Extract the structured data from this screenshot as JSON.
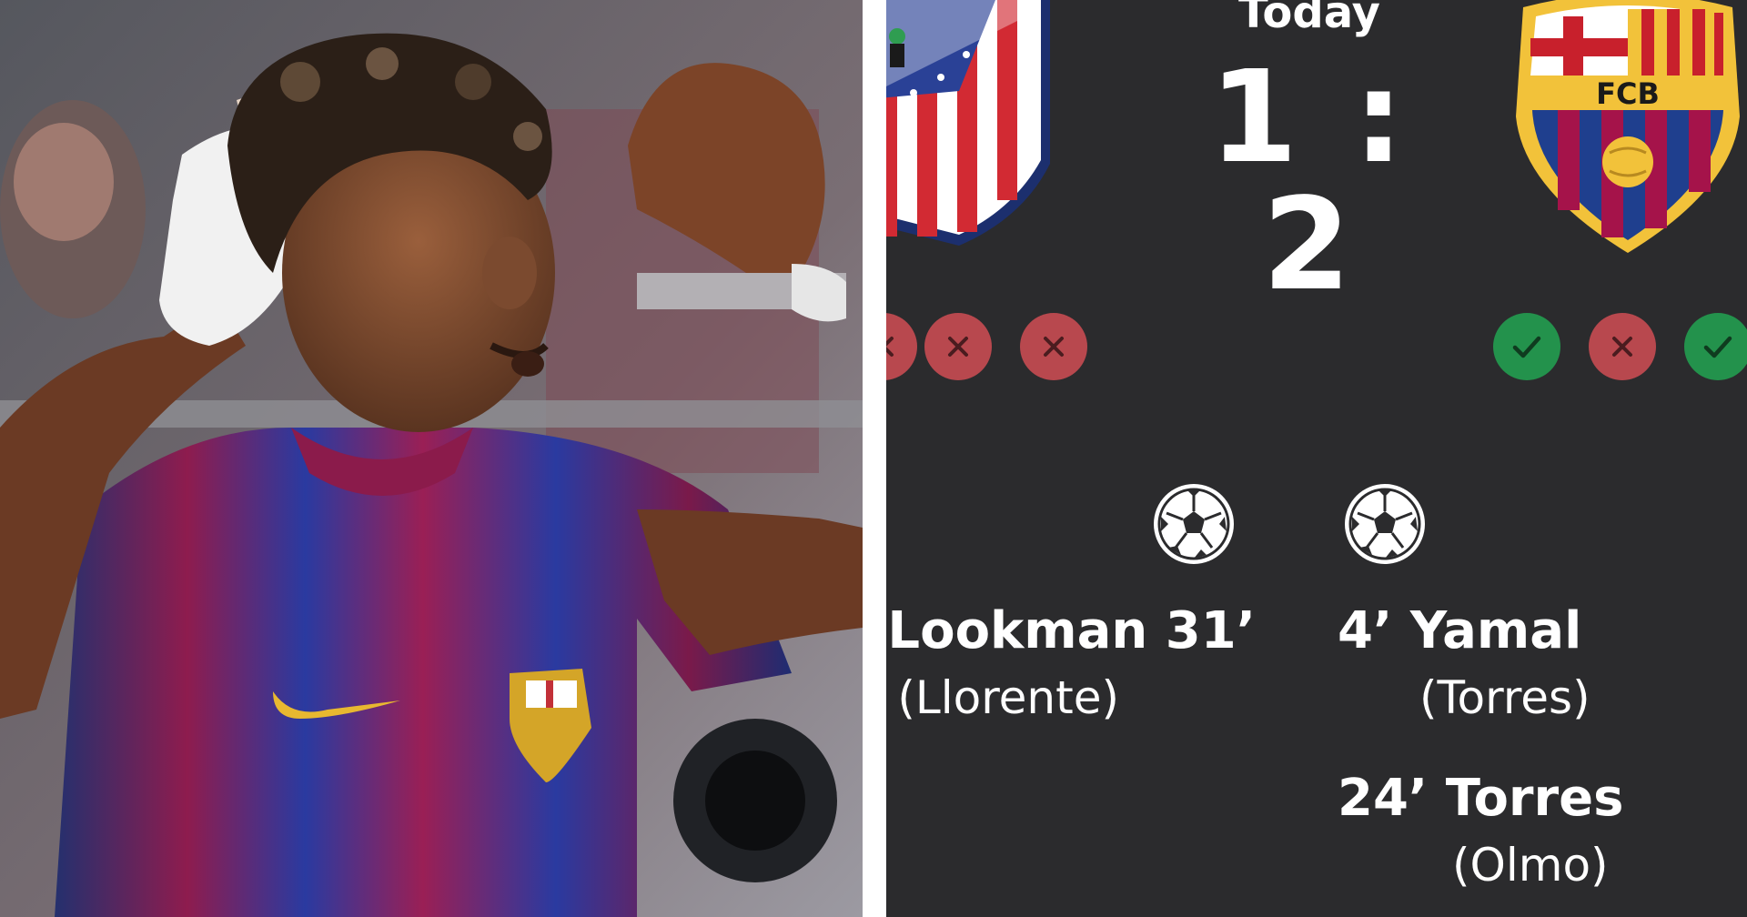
{
  "match": {
    "date_label": "Today",
    "home_score": "1",
    "separator": ":",
    "away_score": "2",
    "score_text": "1 : 2"
  },
  "form": {
    "home": [
      "loss",
      "loss",
      "loss"
    ],
    "away": [
      "win",
      "loss",
      "win"
    ]
  },
  "goals": {
    "home": [
      {
        "scorer": "Lookman 31’",
        "assist": "(Llorente)"
      }
    ],
    "away": [
      {
        "scorer": "4’ Yamal",
        "assist": "(Torres)"
      },
      {
        "scorer": "24’ Torres",
        "assist": "(Olmo)"
      }
    ]
  },
  "crest_away": {
    "initials": "FCB"
  },
  "colors": {
    "panel_bg": "#2b2b2d",
    "loss": "#b8484e",
    "win": "#23924c",
    "home_red": "#d22a33",
    "away_blue": "#1f3f8e",
    "away_red": "#a5134a",
    "away_yellow": "#f2c23a"
  }
}
